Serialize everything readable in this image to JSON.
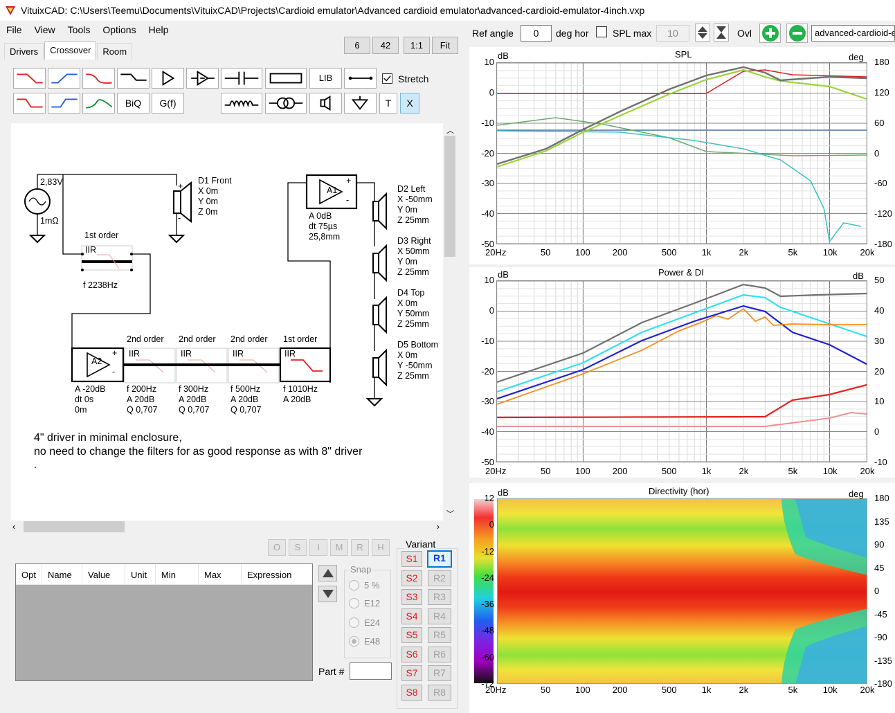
{
  "window": {
    "title": "VituixCAD: C:\\Users\\Teemu\\Documents\\VituixCAD\\Projects\\Cardioid emulator\\Advanced cardioid emulator\\advanced-cardioid-emulator-4inch.vxp"
  },
  "menu": [
    "File",
    "View",
    "Tools",
    "Options",
    "Help"
  ],
  "tabs": [
    "Drivers",
    "Crossover",
    "Room"
  ],
  "zoom": [
    "6",
    "42",
    "1:1",
    "Fit"
  ],
  "toolbar": {
    "ref_angle_label": "Ref angle",
    "ref_angle_value": "0",
    "deg_hor": "deg hor",
    "spl_max_label": "SPL max",
    "spl_max_value": "10",
    "ovl_label": "Ovl",
    "project_name": "advanced-cardioid-e"
  },
  "tools": {
    "lib": "LIB",
    "biq": "BiQ",
    "gf": "G(f)",
    "stretch": "Stretch",
    "t": "T",
    "x": "X"
  },
  "schematic": {
    "source": {
      "voltage": "2,83V",
      "res": "1mΩ"
    },
    "d1": [
      "D1 Front",
      "X 0m",
      "Y 0m",
      "Z 0m"
    ],
    "filter1": {
      "title": "1st order",
      "type": "IIR",
      "f": "f   2238Hz"
    },
    "amp1": {
      "label": "A1",
      "lines": [
        "A  0dB",
        "dt 75µs",
        "     25,8mm"
      ]
    },
    "amp2": {
      "label": "A2",
      "lines": [
        "A  -20dB",
        "dt 0s",
        "     0m"
      ]
    },
    "d2": [
      "D2 Left",
      "X -50mm",
      "Y 0m",
      "Z 25mm"
    ],
    "d3": [
      "D3 Right",
      "X 50mm",
      "Y 0m",
      "Z 25mm"
    ],
    "d4": [
      "D4 Top",
      "X 0m",
      "Y 50mm",
      "Z 25mm"
    ],
    "d5": [
      "D5 Bottom",
      "X 0m",
      "Y -50mm",
      "Z 25mm"
    ],
    "f2": {
      "title": "2nd order",
      "type": "IIR",
      "lines": [
        "f   200Hz",
        "A  20dB",
        "Q  0,707"
      ]
    },
    "f3": {
      "title": "2nd order",
      "type": "IIR",
      "lines": [
        "f   300Hz",
        "A  20dB",
        "Q  0,707"
      ]
    },
    "f4": {
      "title": "2nd order",
      "type": "IIR",
      "lines": [
        "f   500Hz",
        "A  20dB",
        "Q  0,707"
      ]
    },
    "f5": {
      "title": "1st order",
      "type": "IIR",
      "lines": [
        "f   1010Hz",
        "A  20dB"
      ]
    },
    "note": [
      "4\" driver in minimal enclosure,",
      "no need to change the filters for as good response as with 8\" driver",
      "."
    ]
  },
  "opt_buttons": [
    "O",
    "S",
    "I",
    "M",
    "R",
    "H"
  ],
  "table": {
    "headers": [
      "Opt",
      "Name",
      "Value",
      "Unit",
      "Min",
      "Max",
      "Expression"
    ]
  },
  "snap": {
    "title": "Snap",
    "options": [
      "5 %",
      "E12",
      "E24",
      "E48"
    ],
    "selected": "E48"
  },
  "part": {
    "label": "Part #",
    "value": ""
  },
  "variant": {
    "title": "Variant",
    "s": [
      "S1",
      "S2",
      "S3",
      "S4",
      "S5",
      "S6",
      "S7",
      "S8"
    ],
    "r": [
      "R1",
      "R2",
      "R3",
      "R4",
      "R5",
      "R6",
      "R7",
      "R8"
    ],
    "selected": "R1"
  },
  "freq_ticks": [
    "20Hz",
    "50",
    "100",
    "200",
    "500",
    "1k",
    "2k",
    "5k",
    "10k",
    "20k"
  ],
  "charts": [
    {
      "title": "SPL",
      "left_unit": "dB",
      "right_unit": "deg",
      "left_ticks": [
        "10",
        "0",
        "-10",
        "-20",
        "-30",
        "-40",
        "-50"
      ],
      "right_ticks": [
        "180",
        "120",
        "60",
        "0",
        "-60",
        "-120",
        "-180"
      ]
    },
    {
      "title": "Power & DI",
      "left_unit": "dB",
      "right_unit": "dB",
      "left_ticks": [
        "10",
        "0",
        "-10",
        "-20",
        "-30",
        "-40",
        "-50"
      ],
      "right_ticks": [
        "50",
        "40",
        "30",
        "20",
        "10",
        "0",
        "-10"
      ]
    },
    {
      "title": "Directivity (hor)",
      "left_unit": "dB",
      "right_unit": "deg",
      "left_ticks": [
        "12",
        "0",
        "-12",
        "-24",
        "-36",
        "-48",
        "-60",
        "-72"
      ],
      "right_ticks": [
        "180",
        "135",
        "90",
        "45",
        "0",
        "-45",
        "-90",
        "-135",
        "-180"
      ]
    }
  ]
}
